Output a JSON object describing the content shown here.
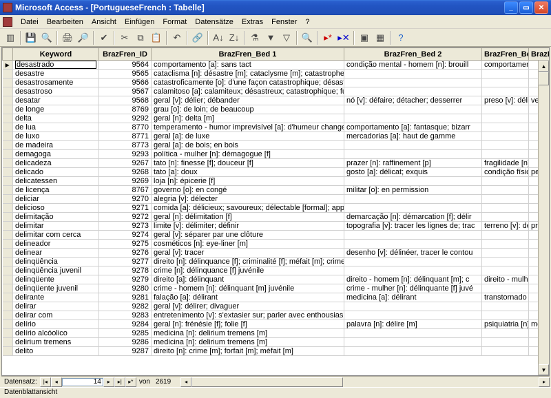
{
  "window": {
    "title": "Microsoft Access - [PortugueseFrench : Tabelle]"
  },
  "menu": {
    "items": [
      "Datei",
      "Bearbeiten",
      "Ansicht",
      "Einfügen",
      "Format",
      "Datensätze",
      "Extras",
      "Fenster",
      "?"
    ]
  },
  "columns": [
    "Keyword",
    "BrazFren_ID",
    "BrazFren_Bed 1",
    "BrazFren_Bed 2",
    "BrazFren_Bed",
    "BrazFrer"
  ],
  "nav": {
    "label": "Datensatz:",
    "pos": "14",
    "of": "von",
    "total": "2619"
  },
  "status": "Datenblattansicht",
  "rows": [
    {
      "k": "desastrado",
      "id": "9564",
      "b1": "comportamento [a]: sans tact",
      "b2": "condição mental - homem [n]: brouill",
      "b3": "comportamento",
      "b4": ""
    },
    {
      "k": "desastre",
      "id": "9565",
      "b1": "cataclisma [n]: désastre [m]; cataclysme [m]; catastrophe",
      "b2": "",
      "b3": "",
      "b4": ""
    },
    {
      "k": "desastrosamente",
      "id": "9566",
      "b1": "catastroficamente [o]: d'une façon catastrophique; désastre",
      "b2": "",
      "b3": "",
      "b4": ""
    },
    {
      "k": "desastroso",
      "id": "9567",
      "b1": "calamitoso [a]: calamiteux; désastreux; catastrophique; fun",
      "b2": "",
      "b3": "",
      "b4": ""
    },
    {
      "k": "desatar",
      "id": "9568",
      "b1": "geral [v]: délier; débander",
      "b2": "nó [v]: défaire; détacher; desserrer",
      "b3": "preso [v]: délier",
      "b4": "vestimen"
    },
    {
      "k": "de longe",
      "id": "8769",
      "b1": "grau [o]: de loin; de beaucoup",
      "b2": "",
      "b3": "",
      "b4": ""
    },
    {
      "k": "delta",
      "id": "9292",
      "b1": "geral [n]: delta [m]",
      "b2": "",
      "b3": "",
      "b4": ""
    },
    {
      "k": "de lua",
      "id": "8770",
      "b1": "temperamento - humor imprevisível [a]: d'humeur changeant",
      "b2": "comportamento [a]: fantasque; bizarr",
      "b3": "",
      "b4": ""
    },
    {
      "k": "de luxo",
      "id": "8771",
      "b1": "geral [a]: de luxe",
      "b2": "mercadorias [a]: haut de gamme",
      "b3": "",
      "b4": ""
    },
    {
      "k": "de madeira",
      "id": "8773",
      "b1": "geral [a]: de bois; en bois",
      "b2": "",
      "b3": "",
      "b4": ""
    },
    {
      "k": "demagoga",
      "id": "9293",
      "b1": "política - mulher [n]: démagogue [f]",
      "b2": "",
      "b3": "",
      "b4": ""
    },
    {
      "k": "delicadeza",
      "id": "9267",
      "b1": "tato [n]: finesse [f]; douceur [f]",
      "b2": "prazer [n]: raffinement [p]",
      "b3": "fragilidade [n]: d",
      "b4": ""
    },
    {
      "k": "delicado",
      "id": "9268",
      "b1": "tato [a]: doux",
      "b2": "gosto [a]: délicat; exquis",
      "b3": "condição física",
      "b4": "pele [a]:"
    },
    {
      "k": "delicatessen",
      "id": "9269",
      "b1": "loja [n]: épicerie [f]",
      "b2": "",
      "b3": "",
      "b4": ""
    },
    {
      "k": "de licença",
      "id": "8767",
      "b1": "governo [o]: en congé",
      "b2": "militar [o]: en permission",
      "b3": "",
      "b4": ""
    },
    {
      "k": "deliciar",
      "id": "9270",
      "b1": "alegria [v]: délecter",
      "b2": "",
      "b3": "",
      "b4": ""
    },
    {
      "k": "delicioso",
      "id": "9271",
      "b1": "comida [a]: délicieux; savoureux; délectable [formal]; appéti",
      "b2": "",
      "b3": "",
      "b4": ""
    },
    {
      "k": "delimitação",
      "id": "9272",
      "b1": "geral [n]: délimitation [f]",
      "b2": "demarcação [n]: démarcation [f]; délir",
      "b3": "",
      "b4": ""
    },
    {
      "k": "delimitar",
      "id": "9273",
      "b1": "limite [v]: délimiter; définir",
      "b2": "topografia [v]: tracer les lignes de; trac",
      "b3": "terreno [v]: délir",
      "b4": "propriedad"
    },
    {
      "k": "delimitar com cerca",
      "id": "9274",
      "b1": "geral [v]: séparer par une clôture",
      "b2": "",
      "b3": "",
      "b4": ""
    },
    {
      "k": "delineador",
      "id": "9275",
      "b1": "cosméticos [n]: eye-liner [m]",
      "b2": "",
      "b3": "",
      "b4": ""
    },
    {
      "k": "delinear",
      "id": "9276",
      "b1": "geral [v]: tracer",
      "b2": "desenho [v]: délinéer, tracer le contou",
      "b3": "",
      "b4": ""
    },
    {
      "k": "delinqüência",
      "id": "9277",
      "b1": "direito [n]: délinquance [f]; criminalité [f]; méfait [m]; crime [m",
      "b2": "",
      "b3": "",
      "b4": ""
    },
    {
      "k": "delinqüência juvenil",
      "id": "9278",
      "b1": "crime [n]: délinquance [f] juvénile",
      "b2": "",
      "b3": "",
      "b4": ""
    },
    {
      "k": "delinqüente",
      "id": "9279",
      "b1": "direito [a]: délinquant",
      "b2": "direito - homem [n]: délinquant [m]; c",
      "b3": "direito - mulher",
      "b4": ""
    },
    {
      "k": "delinqüente juvenil",
      "id": "9280",
      "b1": "crime - homem [n]: délinquant [m] juvénile",
      "b2": "crime - mulher [n]: délinquante [f] juvé",
      "b3": "",
      "b4": ""
    },
    {
      "k": "delirante",
      "id": "9281",
      "b1": "falação [a]: délirant",
      "b2": "medicina [a]: délirant",
      "b3": "transtornado",
      "b4": ""
    },
    {
      "k": "delirar",
      "id": "9282",
      "b1": "geral [v]: délirer; divaguer",
      "b2": "",
      "b3": "",
      "b4": ""
    },
    {
      "k": "delirar com",
      "id": "9283",
      "b1": "entretenimento [v]: s'extasier sur; parler avec enthousiasme",
      "b2": "",
      "b3": "",
      "b4": ""
    },
    {
      "k": "delírio",
      "id": "9284",
      "b1": "geral [n]: frénésie [f]; folie [f]",
      "b2": "palavra [n]: délire [m]",
      "b3": "psiquiatria [n]: f",
      "b4": "medicina"
    },
    {
      "k": "delírio alcóolico",
      "id": "9285",
      "b1": "medicina [n]: delirium tremens [m]",
      "b2": "",
      "b3": "",
      "b4": ""
    },
    {
      "k": "delirium tremens",
      "id": "9286",
      "b1": "medicina [n]: delirium tremens [m]",
      "b2": "",
      "b3": "",
      "b4": ""
    },
    {
      "k": "delito",
      "id": "9287",
      "b1": "direito [n]: crime [m]; forfait [m]; méfait [m]",
      "b2": "",
      "b3": "",
      "b4": ""
    }
  ]
}
